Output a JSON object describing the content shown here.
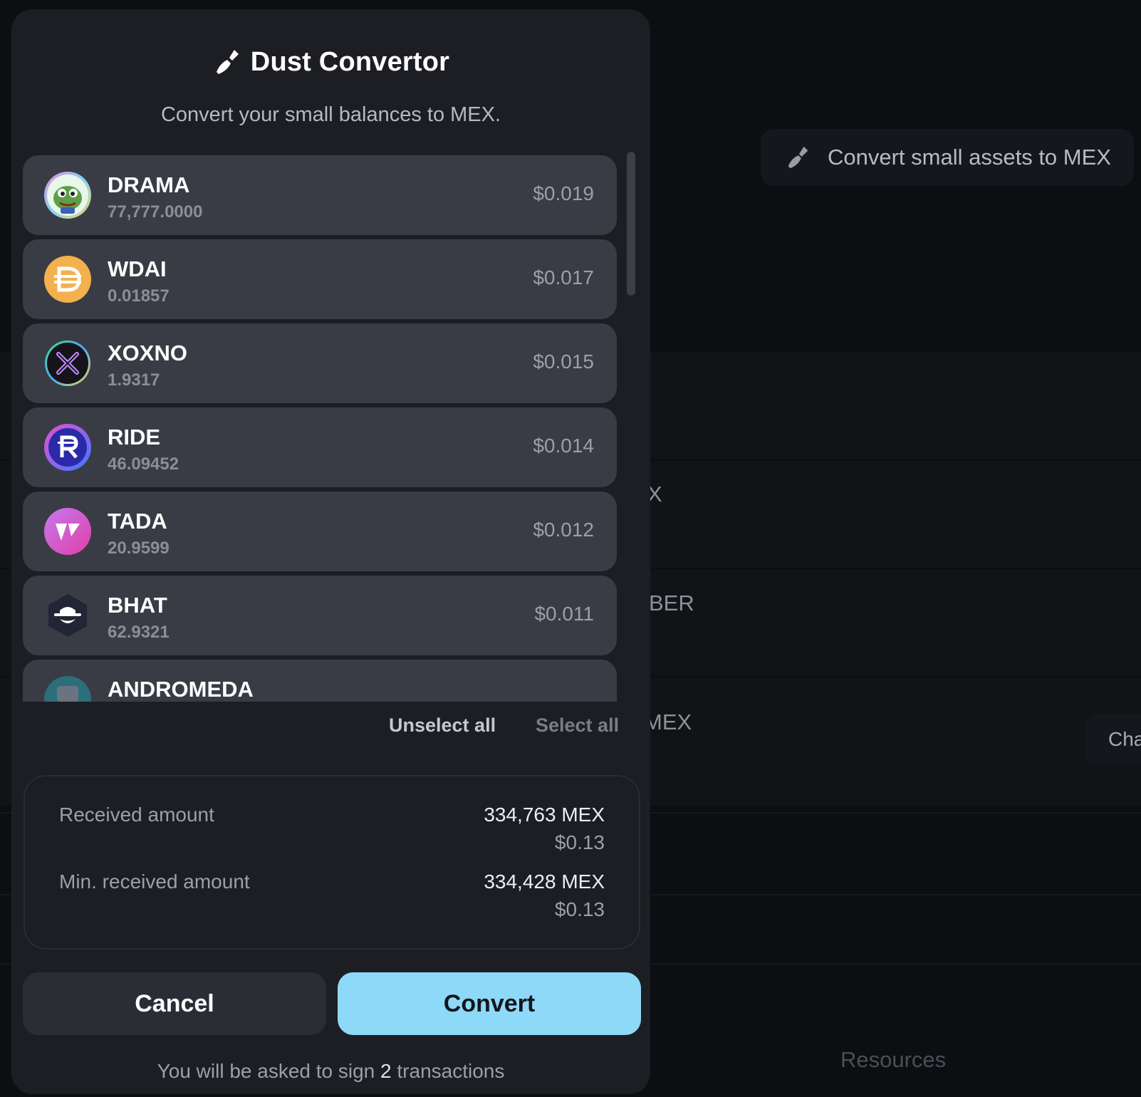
{
  "modal": {
    "title": "Dust Convertor",
    "subtitle": "Convert your small balances to MEX.",
    "icon": "broom-icon",
    "tokens": [
      {
        "symbol": "DRAMA",
        "balance": "77,777.0000",
        "usd": "$0.019",
        "logo": "pepe-frog-icon"
      },
      {
        "symbol": "WDAI",
        "balance": "0.01857",
        "usd": "$0.017",
        "logo": "dai-icon"
      },
      {
        "symbol": "XOXNO",
        "balance": "1.9317",
        "usd": "$0.015",
        "logo": "xoxno-x-icon"
      },
      {
        "symbol": "RIDE",
        "balance": "46.09452",
        "usd": "$0.014",
        "logo": "ride-r-icon"
      },
      {
        "symbol": "TADA",
        "balance": "20.9599",
        "usd": "$0.012",
        "logo": "tada-icon"
      },
      {
        "symbol": "BHAT",
        "balance": "62.9321",
        "usd": "$0.011",
        "logo": "black-hat-icon"
      },
      {
        "symbol": "ANDROMEDA",
        "balance": "",
        "usd": "",
        "logo": "andromeda-icon"
      }
    ],
    "unselect_all": "Unselect all",
    "select_all": "Select all",
    "summary": {
      "received_label": "Received amount",
      "received_mex": "334,763 MEX",
      "received_usd": "$0.13",
      "min_label": "Min. received amount",
      "min_mex": "334,428 MEX",
      "min_usd": "$0.13"
    },
    "cancel_label": "Cancel",
    "convert_label": "Convert",
    "note_prefix": "You will be asked to sign ",
    "note_count": "2",
    "note_suffix": " transactions"
  },
  "background": {
    "pill_label": "Convert small assets to MEX",
    "fragment_1": "X",
    "fragment_2": "BER",
    "fragment_3": "MEX",
    "chip_label": "Cha",
    "resources": "Resources"
  },
  "colors": {
    "accent": "#8fd9f8",
    "modal_bg": "#1d1e23",
    "row_bg": "#3a3c45"
  }
}
